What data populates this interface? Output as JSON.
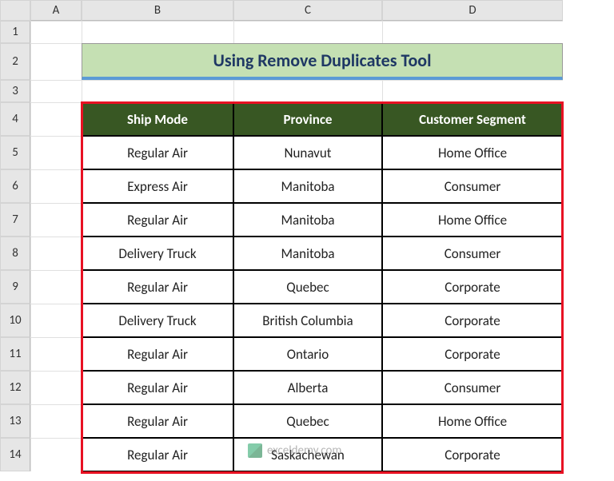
{
  "columns": [
    "A",
    "B",
    "C",
    "D"
  ],
  "rows": [
    "1",
    "2",
    "3",
    "4",
    "5",
    "6",
    "7",
    "8",
    "9",
    "10",
    "11",
    "12",
    "13",
    "14"
  ],
  "title": "Using Remove Duplicates Tool",
  "headers": [
    "Ship Mode",
    "Province",
    "Customer Segment"
  ],
  "data": [
    [
      "Regular Air",
      "Nunavut",
      "Home Office"
    ],
    [
      "Express Air",
      "Manitoba",
      "Consumer"
    ],
    [
      "Regular Air",
      "Manitoba",
      "Home Office"
    ],
    [
      "Delivery Truck",
      "Manitoba",
      "Consumer"
    ],
    [
      "Regular Air",
      "Quebec",
      "Corporate"
    ],
    [
      "Delivery Truck",
      "British Columbia",
      "Corporate"
    ],
    [
      "Regular Air",
      "Ontario",
      "Corporate"
    ],
    [
      "Regular Air",
      "Alberta",
      "Consumer"
    ],
    [
      "Regular Air",
      "Quebec",
      "Home Office"
    ],
    [
      "Regular Air",
      "Saskachewan",
      "Corporate"
    ]
  ],
  "watermark": "exceldemy.com",
  "chart_data": {
    "type": "table",
    "title": "Using Remove Duplicates Tool",
    "columns": [
      "Ship Mode",
      "Province",
      "Customer Segment"
    ],
    "rows": [
      [
        "Regular Air",
        "Nunavut",
        "Home Office"
      ],
      [
        "Express Air",
        "Manitoba",
        "Consumer"
      ],
      [
        "Regular Air",
        "Manitoba",
        "Home Office"
      ],
      [
        "Delivery Truck",
        "Manitoba",
        "Consumer"
      ],
      [
        "Regular Air",
        "Quebec",
        "Corporate"
      ],
      [
        "Delivery Truck",
        "British Columbia",
        "Corporate"
      ],
      [
        "Regular Air",
        "Ontario",
        "Corporate"
      ],
      [
        "Regular Air",
        "Alberta",
        "Consumer"
      ],
      [
        "Regular Air",
        "Quebec",
        "Home Office"
      ],
      [
        "Regular Air",
        "Saskachewan",
        "Corporate"
      ]
    ]
  }
}
